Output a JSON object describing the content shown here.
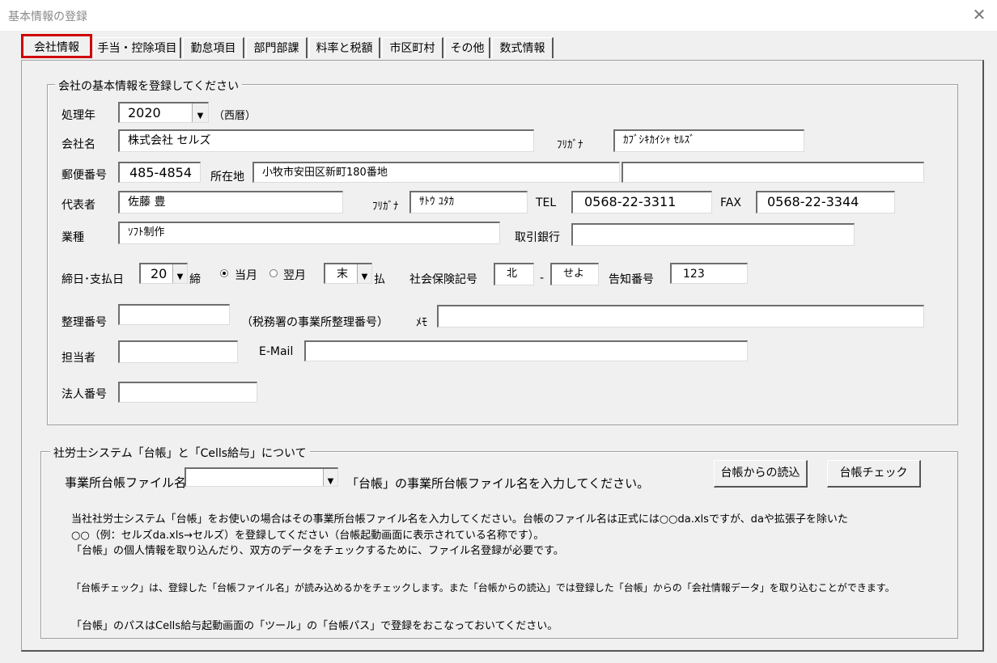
{
  "window": {
    "title": "基本情報の登録",
    "close_icon": "close-icon"
  },
  "tabs": [
    "会社情報",
    "手当・控除項目",
    "勤怠項目",
    "部門部課",
    "料率と税額",
    "市区町村",
    "その他",
    "数式情報"
  ],
  "company_group": {
    "legend": "会社の基本情報を登録してください",
    "processing_year_label": "処理年",
    "processing_year": "2020",
    "era_note": "（西暦）",
    "company_name_label": "会社名",
    "company_name": "株式会社 セルズ",
    "furigana_label": "ﾌﾘｶﾞﾅ",
    "company_furigana": "ｶﾌﾞｼｷｶｲｼｬ ｾﾙｽﾞ",
    "postal_label": "郵便番号",
    "postal_code": "485-4854",
    "address_label": "所在地",
    "address1": "小牧市安田区新町180番地",
    "address2": "",
    "representative_label": "代表者",
    "representative": "佐藤 豊",
    "rep_furigana_label": "ﾌﾘｶﾞﾅ",
    "rep_furigana": "ｻﾄｳ ﾕﾀｶ",
    "tel_label": "TEL",
    "tel": "0568-22-3311",
    "fax_label": "FAX",
    "fax": "0568-22-3344",
    "industry_label": "業種",
    "industry": "ｿﾌﾄ制作",
    "bank_label": "取引銀行",
    "bank": "",
    "closing_label": "締日･支払日",
    "closing_day": "20",
    "closing_suffix": "締",
    "radio_this_month": "当月",
    "radio_next_month": "翌月",
    "pay_day": "末",
    "pay_suffix": "払",
    "insurance_label": "社会保険記号",
    "insurance_code1": "北",
    "insurance_dash": "-",
    "insurance_code2": "せよ",
    "notice_label": "告知番号",
    "notice_number": "123",
    "ref_number_label": "整理番号",
    "ref_number": "",
    "ref_note": "（税務署の事業所整理番号）",
    "memo_label": "ﾒﾓ",
    "memo": "",
    "person_label": "担当者",
    "person": "",
    "email_label": "E-Mail",
    "email": "",
    "corp_number_label": "法人番号",
    "corp_number": ""
  },
  "ledger_group": {
    "legend": "社労士システム「台帳」と「Cells給与」について",
    "file_label": "事業所台帳ファイル名",
    "file_value": "",
    "file_hint": "「台帳」の事業所台帳ファイル名を入力してください。",
    "read_button": "台帳からの読込",
    "check_button": "台帳チェック",
    "notes": [
      "当社社労士システム「台帳」をお使いの場合はその事業所台帳ファイル名を入力してください。台帳のファイル名は正式には○○da.xlsですが、daや拡張子を除いた",
      "○○（例：セルズda.xls→セルズ）を登録してください（台帳起動画面に表示されている名称です）。",
      "「台帳」の個人情報を取り込んだり、双方のデータをチェックするために、ファイル名登録が必要です。",
      "「台帳チェック」は、登録した「台帳ファイル名」が読み込めるかをチェックします。また「台帳からの読込」では登録した「台帳」からの「会社情報データ」を取り込むことができます。",
      "「台帳」のパスはCells給与起動画面の「ツール」の「台帳パス」で登録をおこなっておいてください。"
    ]
  },
  "colors": {
    "active_tab_border": "#d00000",
    "background": "#f0f0f0"
  }
}
